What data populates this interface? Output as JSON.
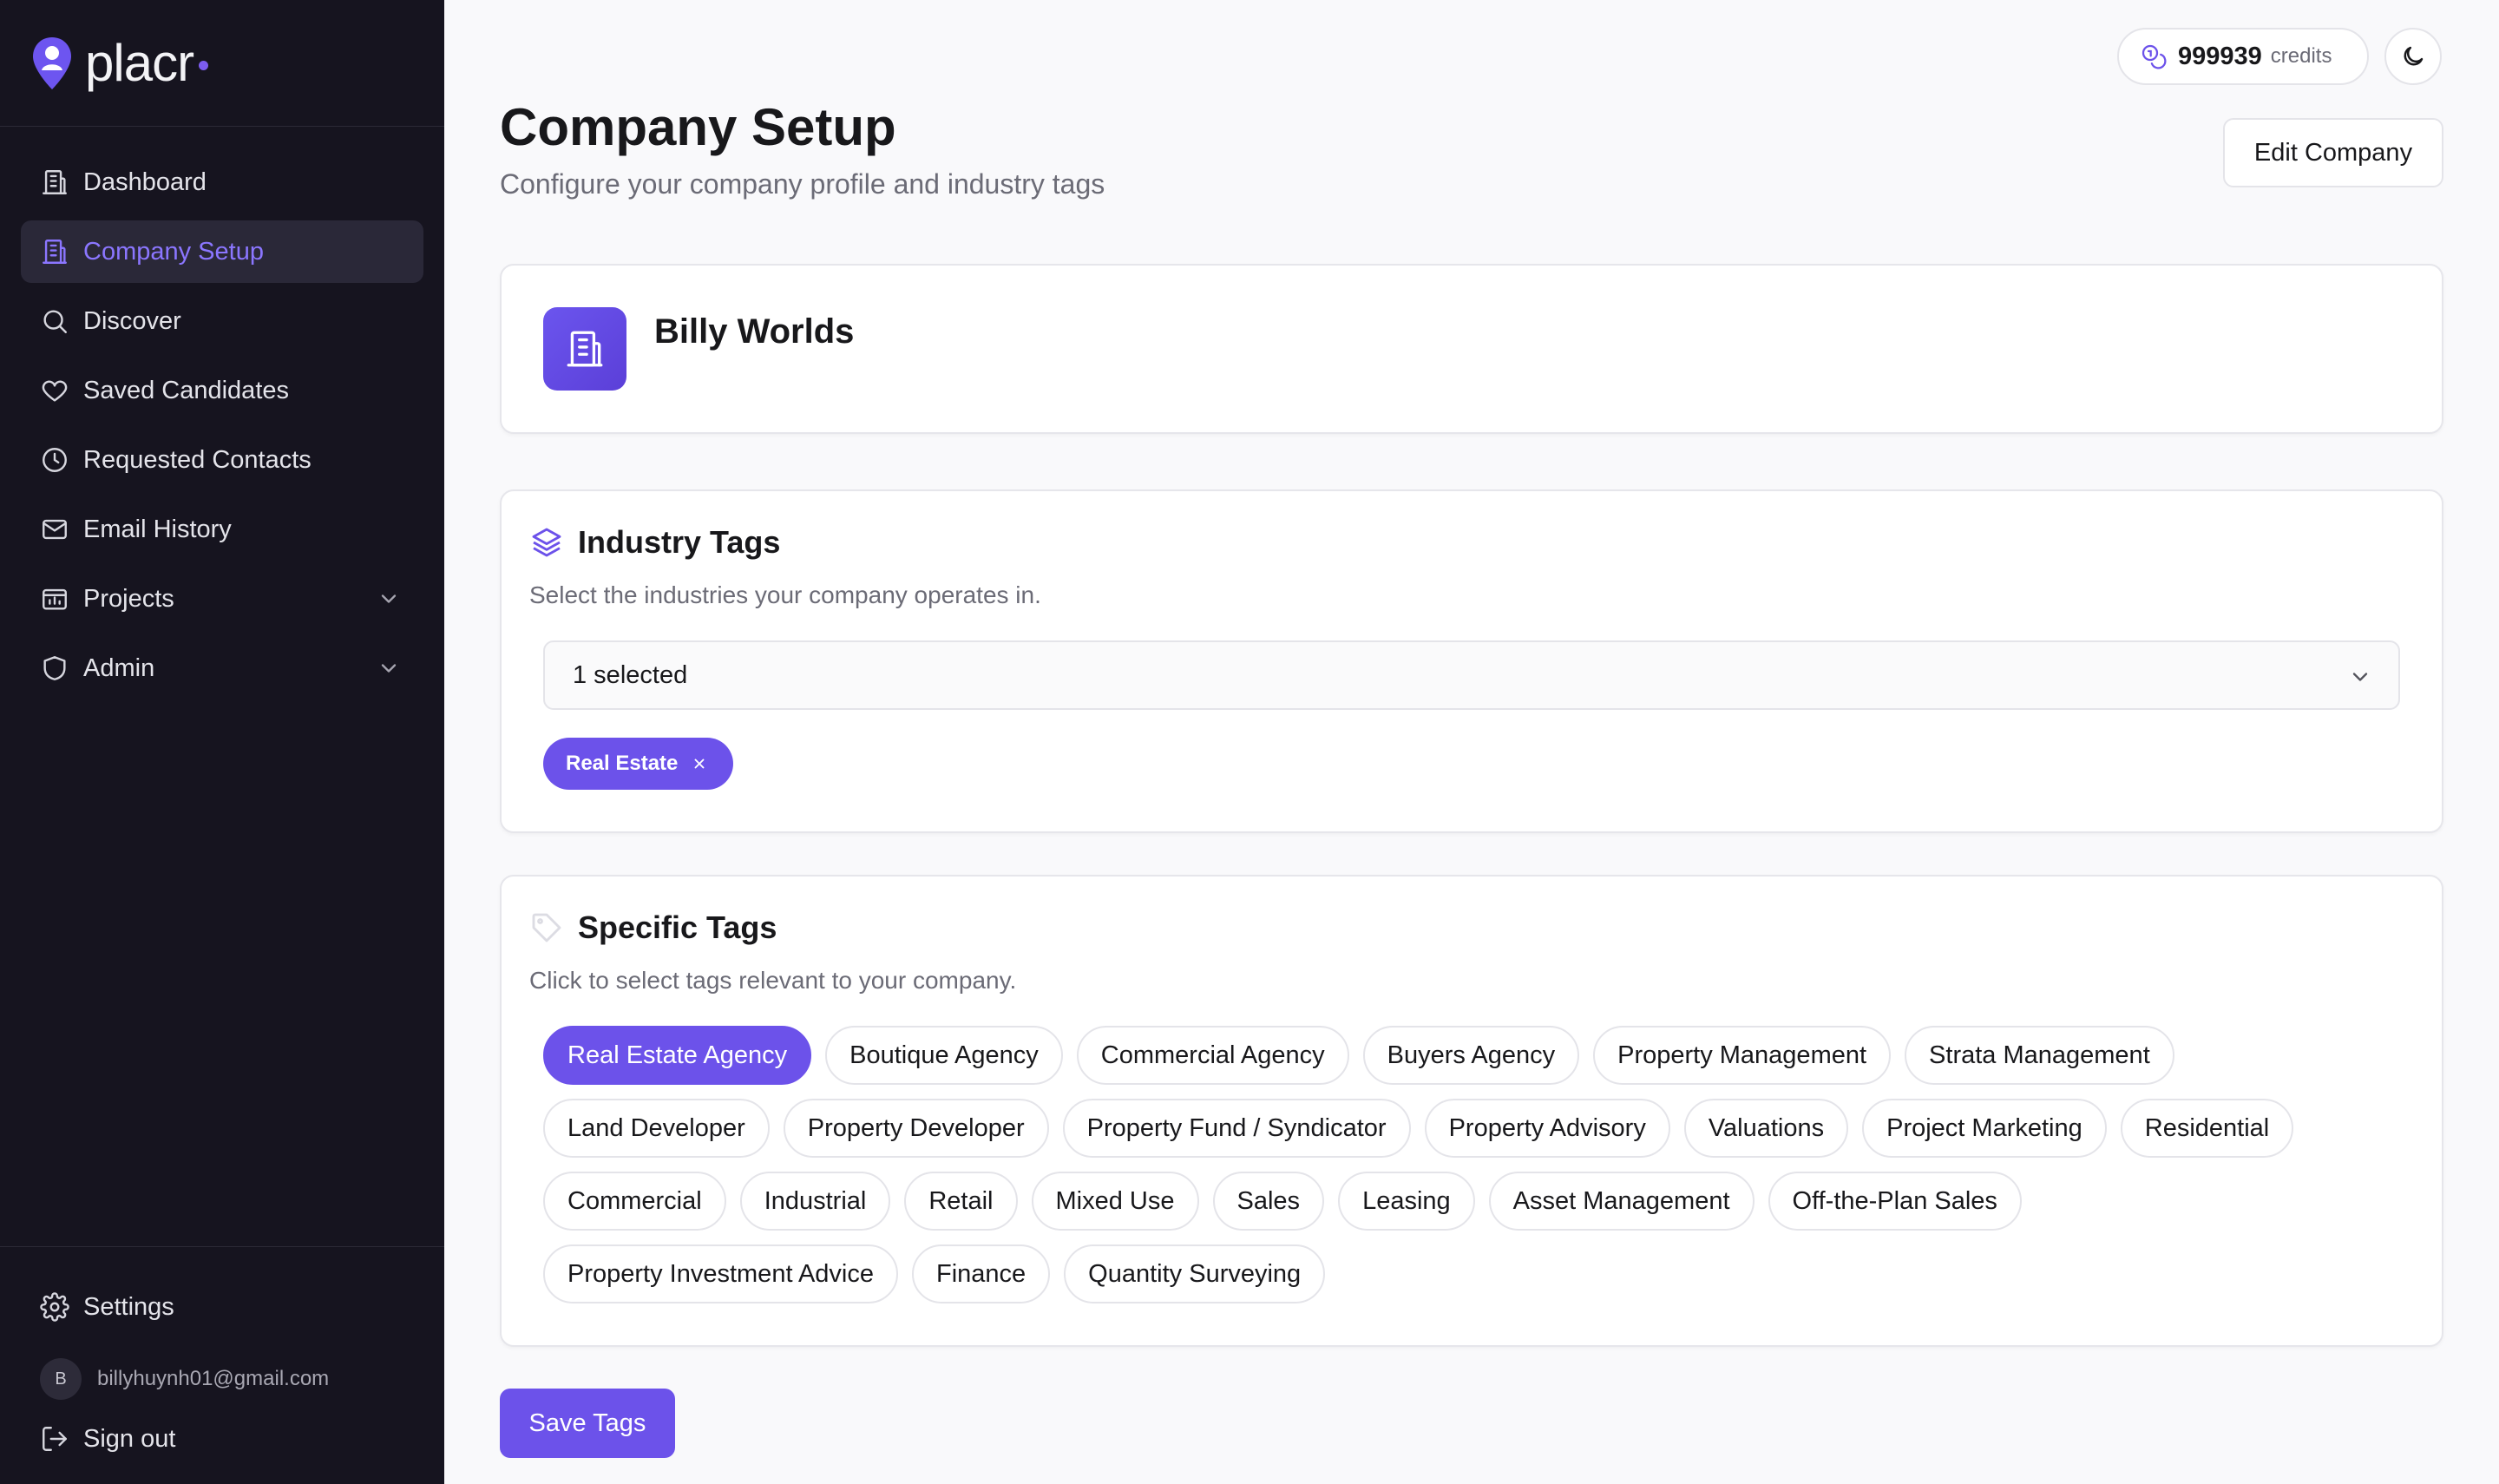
{
  "app": {
    "name": "placr"
  },
  "sidebar": {
    "items": [
      {
        "label": "Dashboard"
      },
      {
        "label": "Company Setup"
      },
      {
        "label": "Discover"
      },
      {
        "label": "Saved Candidates"
      },
      {
        "label": "Requested Contacts"
      },
      {
        "label": "Email History"
      },
      {
        "label": "Projects"
      },
      {
        "label": "Admin"
      }
    ],
    "settings_label": "Settings",
    "user_initial": "B",
    "user_email": "billyhuynh01@gmail.com",
    "signout_label": "Sign out"
  },
  "header": {
    "credits_value": "999939",
    "credits_label": "credits",
    "title": "Company Setup",
    "subtitle": "Configure your company profile and industry tags",
    "edit_label": "Edit Company"
  },
  "company": {
    "name": "Billy Worlds"
  },
  "industry": {
    "title": "Industry Tags",
    "description": "Select the industries your company operates in.",
    "select_value": "1 selected",
    "selected_tag": "Real Estate"
  },
  "specific": {
    "title": "Specific Tags",
    "description": "Click to select tags relevant to your company.",
    "tags": [
      "Real Estate Agency",
      "Boutique Agency",
      "Commercial Agency",
      "Buyers Agency",
      "Property Management",
      "Strata Management",
      "Land Developer",
      "Property Developer",
      "Property Fund / Syndicator",
      "Property Advisory",
      "Valuations",
      "Project Marketing",
      "Residential",
      "Commercial",
      "Industrial",
      "Retail",
      "Mixed Use",
      "Sales",
      "Leasing",
      "Asset Management",
      "Off-the-Plan Sales",
      "Property Investment Advice",
      "Finance",
      "Quantity Surveying"
    ]
  },
  "actions": {
    "save_label": "Save Tags"
  },
  "colors": {
    "accent": "#6c52ea",
    "sidebar_bg": "#16141f",
    "page_bg": "#f9f9fb"
  }
}
